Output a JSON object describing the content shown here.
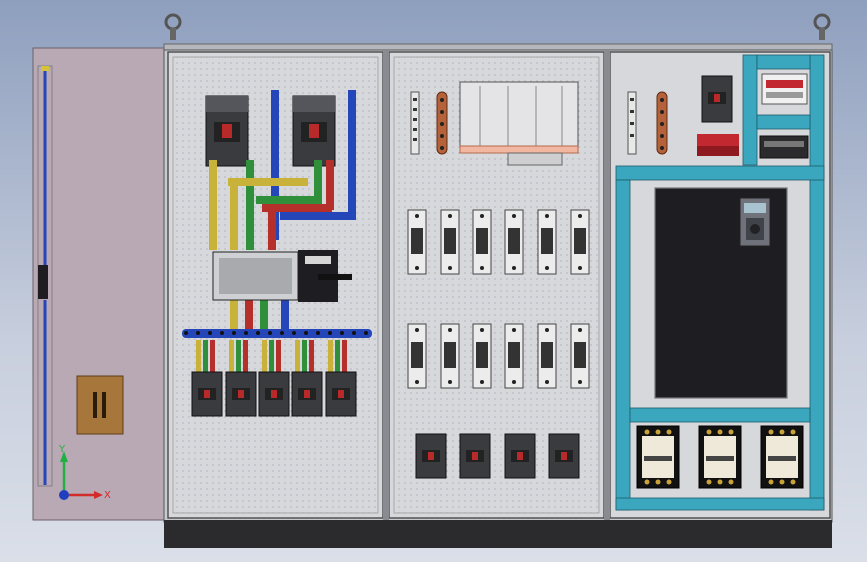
{
  "scene": {
    "triad": {
      "x_label": "X",
      "y_label": "Y"
    },
    "colors": {
      "background_top": "#8e9fbe",
      "background_bottom": "#dadfe8",
      "panel": "#d7d8dc",
      "door": "#b8a9b4",
      "busbar_blue": "#2446b8",
      "busbar_green": "#2f8f3a",
      "busbar_yellow": "#c8b23a",
      "busbar_red": "#b5302a",
      "trunking_cyan": "#3aa7bf",
      "drive_black": "#1e1e22",
      "plinth": "#2b2b2e",
      "copper": "#b5623a"
    },
    "icons": [
      "lifting-eye-icon",
      "coordinate-triad-icon"
    ]
  }
}
